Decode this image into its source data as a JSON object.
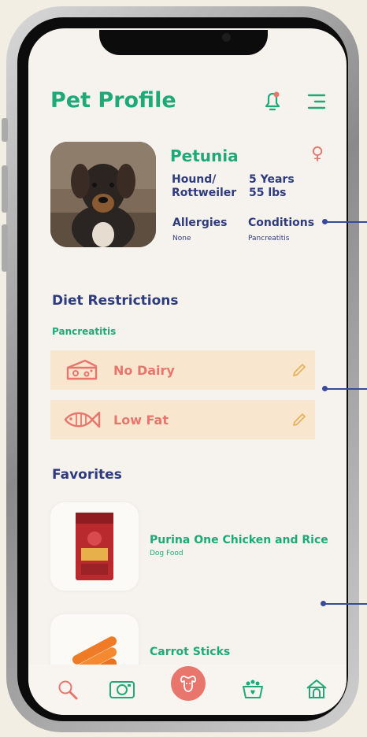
{
  "header": {
    "title": "Pet Profile",
    "bell_icon": "bell-icon",
    "menu_icon": "menu-icon"
  },
  "pet": {
    "name": "Petunia",
    "gender_symbol": "♀",
    "breed_line1": "Hound/",
    "breed_line2": "Rottweiler",
    "age": "5 Years",
    "weight": "55 lbs",
    "allergies_label": "Allergies",
    "allergies_value": "None",
    "conditions_label": "Conditions",
    "conditions_value": "Pancreatitis"
  },
  "diet": {
    "title": "Diet Restrictions",
    "condition": "Pancreatitis",
    "items": [
      {
        "label": "No Dairy",
        "icon": "cheese-icon"
      },
      {
        "label": "Low Fat",
        "icon": "fish-icon"
      }
    ]
  },
  "favorites": {
    "title": "Favorites",
    "items": [
      {
        "name": "Purina One Chicken and Rice",
        "category": "Dog Food"
      },
      {
        "name": "Carrot Sticks",
        "category": ""
      }
    ]
  },
  "tabs": [
    "search-icon",
    "camera-icon",
    "dog-icon",
    "food-bowl-icon",
    "dog-house-icon"
  ],
  "colors": {
    "green": "#1fa978",
    "navy": "#2e3b7d",
    "salmon": "#e9766d",
    "diet_bg": "#f8e6cf"
  }
}
